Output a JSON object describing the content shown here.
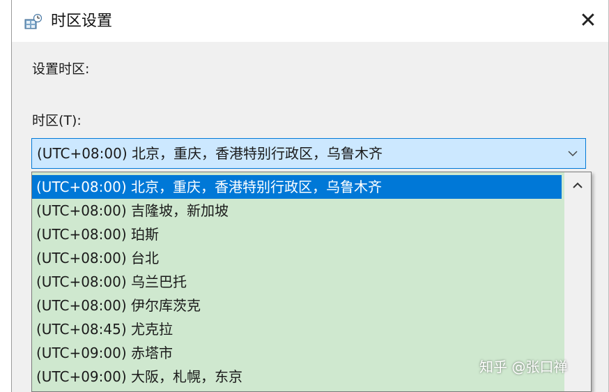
{
  "window": {
    "title": "时区设置",
    "icon": "timezone-settings-icon",
    "close_glyph": "✕"
  },
  "form": {
    "section_label": "设置时区:",
    "field_label": "时区(T):",
    "selected_value": "(UTC+08:00) 北京，重庆，香港特别行政区，乌鲁木齐"
  },
  "dropdown": {
    "items": [
      "(UTC+08:00) 北京，重庆，香港特别行政区，乌鲁木齐",
      "(UTC+08:00) 吉隆坡，新加坡",
      "(UTC+08:00) 珀斯",
      "(UTC+08:00) 台北",
      "(UTC+08:00) 乌兰巴托",
      "(UTC+08:00) 伊尔库茨克",
      "(UTC+08:45) 尤克拉",
      "(UTC+09:00) 赤塔市",
      "(UTC+09:00) 大阪，札幌，东京"
    ],
    "selected_index": 0
  },
  "watermark": "知乎 @张口禅",
  "colors": {
    "selection": "#0078d7",
    "combo_background": "#cce8ff",
    "list_background": "#cfe8cf"
  }
}
